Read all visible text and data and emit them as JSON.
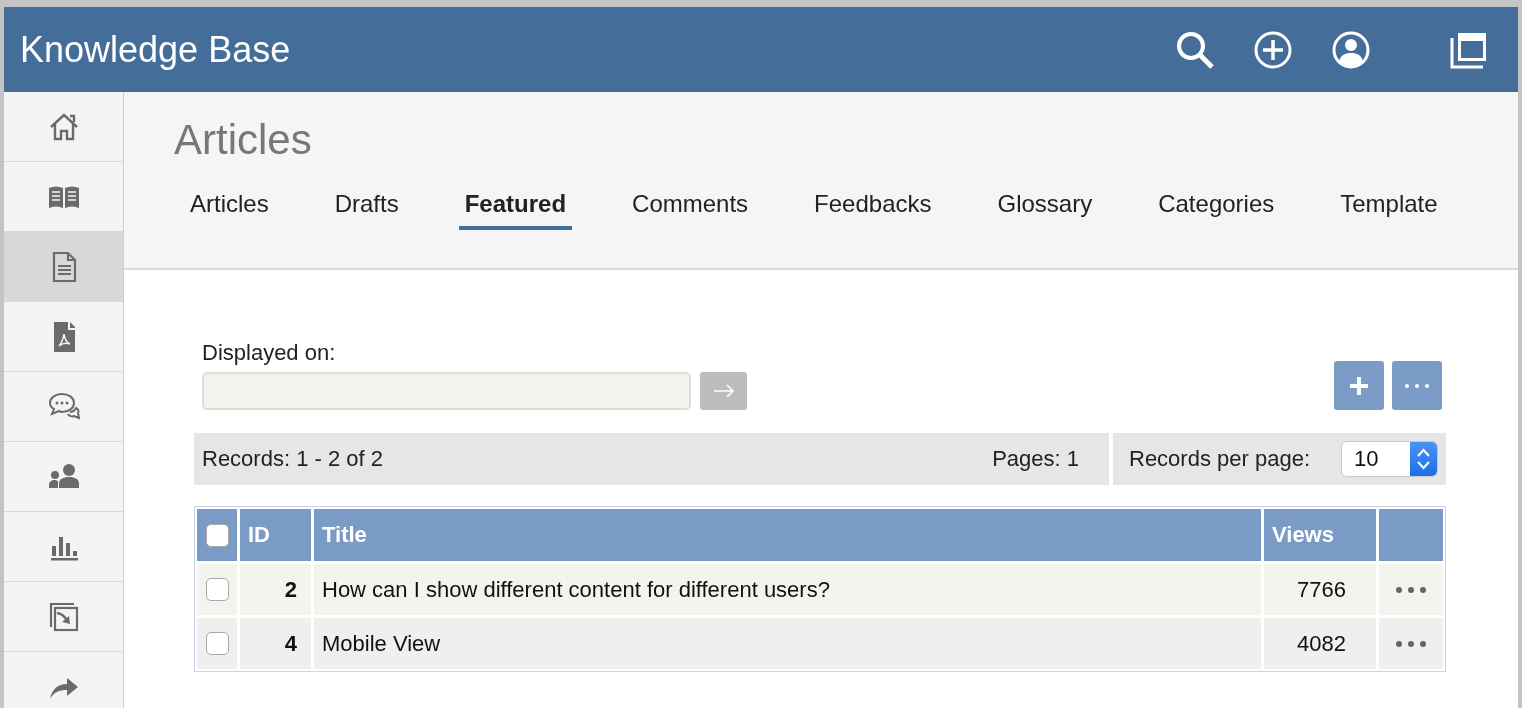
{
  "window": {
    "title": "Knowledge Base"
  },
  "sidebar": {
    "items": [
      {
        "selected": false
      },
      {
        "selected": false
      },
      {
        "selected": true
      },
      {
        "selected": false
      },
      {
        "selected": false
      },
      {
        "selected": false
      },
      {
        "selected": false
      },
      {
        "selected": false
      },
      {
        "selected": false
      }
    ]
  },
  "page": {
    "heading": "Articles",
    "tabs": [
      {
        "label": "Articles",
        "selected": false
      },
      {
        "label": "Drafts",
        "selected": false
      },
      {
        "label": "Featured",
        "selected": true
      },
      {
        "label": "Comments",
        "selected": false
      },
      {
        "label": "Feedbacks",
        "selected": false
      },
      {
        "label": "Glossary",
        "selected": false
      },
      {
        "label": "Categories",
        "selected": false
      },
      {
        "label": "Template",
        "selected": false
      }
    ]
  },
  "filter": {
    "label": "Displayed on:"
  },
  "pager": {
    "records": "Records: 1 - 2 of 2",
    "pages": "Pages: 1",
    "per_page_label": "Records per page:",
    "per_page": "10"
  },
  "table": {
    "select_all": {
      "checked": false
    },
    "columns": [
      "ID",
      "Title",
      "Views"
    ],
    "rows": [
      {
        "checked": false,
        "id": "2",
        "title": "How can I show different content for different users?",
        "views": "7766"
      },
      {
        "checked": false,
        "id": "4",
        "title": "Mobile View",
        "views": "4082"
      }
    ]
  }
}
